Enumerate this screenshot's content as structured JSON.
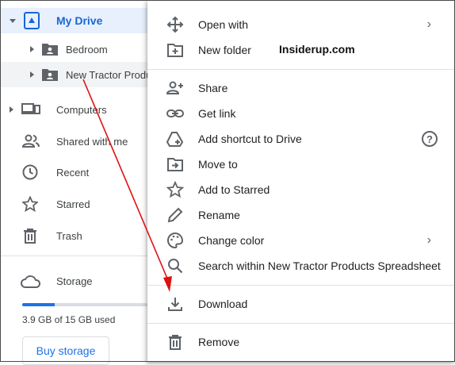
{
  "sidebar": {
    "my_drive": "My Drive",
    "tree": [
      {
        "label": "Bedroom"
      },
      {
        "label": "New Tractor Produ"
      }
    ],
    "nav": [
      {
        "label": "Computers",
        "icon": "computers-icon"
      },
      {
        "label": "Shared with me",
        "icon": "shared-icon"
      },
      {
        "label": "Recent",
        "icon": "clock-icon"
      },
      {
        "label": "Starred",
        "icon": "star-icon"
      },
      {
        "label": "Trash",
        "icon": "trash-icon"
      }
    ],
    "storage": {
      "label": "Storage",
      "usage": "3.9 GB of 15 GB used",
      "fraction_used": 0.26,
      "buy_label": "Buy storage"
    }
  },
  "menu": {
    "watermark": "Insiderup.com",
    "items": [
      {
        "label": "Open with",
        "icon": "move-arrows-icon",
        "submenu": true
      },
      {
        "label": "New folder",
        "icon": "new-folder-icon"
      },
      {
        "label": "Share",
        "icon": "add-person-icon"
      },
      {
        "label": "Get link",
        "icon": "link-icon"
      },
      {
        "label": "Add shortcut to Drive",
        "icon": "add-shortcut-icon",
        "help": true
      },
      {
        "label": "Move to",
        "icon": "move-to-folder-icon"
      },
      {
        "label": "Add to Starred",
        "icon": "star-icon"
      },
      {
        "label": "Rename",
        "icon": "pencil-icon"
      },
      {
        "label": "Change color",
        "icon": "palette-icon",
        "submenu": true
      },
      {
        "label": "Search within New Tractor Products Spreadsheet",
        "icon": "search-icon"
      },
      {
        "label": "Download",
        "icon": "download-icon"
      },
      {
        "label": "Remove",
        "icon": "trash-icon"
      }
    ],
    "help_glyph": "?",
    "chevron_glyph": "›"
  },
  "colors": {
    "accent": "#1a73e8",
    "selected_bg": "#e8f0fe",
    "annotation_arrow": "#e01010"
  }
}
